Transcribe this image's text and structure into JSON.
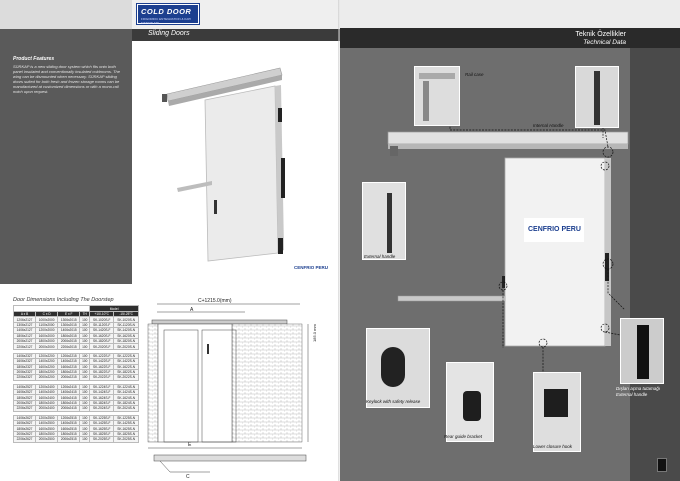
{
  "brand": {
    "logo_text": "COLD DOOR",
    "logo_subtext": "FRIGORIFIC ENTEGRATION & KAPI SISTEMLERI",
    "door_badge": "CENFRIO PERU"
  },
  "left_page": {
    "section_label": "Sliding Doors",
    "features_title": "Product Features",
    "features_text": "SÜRKAP is a new sliding door system which fits onto both panel insulated and conventionally insulated coldrooms. The wing can be dismounted when necessary. SÜRKAP sliding doors suited for both fresh and frozen storage rooms can be manufactured at customized dimensions or with a mono-rail notch upon request.",
    "dimensions_title": "Door Dimensions Including The Doorstep",
    "table": {
      "model_label": "Model",
      "columns": [
        "A x B",
        "C x D",
        "E x F",
        "TH",
        "+10/-10°C",
        "-15/-25°C"
      ],
      "groups": [
        [
          [
            "1206x2127",
            "1000x2000",
            "1306x2015",
            "100",
            "SK-1020S-F",
            "SK-1020S-N"
          ],
          [
            "1306x2127",
            "1100x2000",
            "1306x2015",
            "100",
            "SK-1120S-F",
            "SK-1120S-N"
          ],
          [
            "1406x2127",
            "1200x2000",
            "1406x2015",
            "100",
            "SK-1420S-F",
            "SK-1420S-N"
          ],
          [
            "1806x2127",
            "1600x2000",
            "1806x2015",
            "100",
            "SK-1620S-F",
            "SK-1620S-N"
          ],
          [
            "2006x2127",
            "1800x2000",
            "2006x2015",
            "100",
            "SK-1820S-F",
            "SK-1820S-N"
          ],
          [
            "2206x2127",
            "2000x2000",
            "2206x2015",
            "100",
            "SK-2020S-F",
            "SK-2020S-N"
          ]
        ],
        [
          [
            "1406x2327",
            "1200x2200",
            "1206x2215",
            "100",
            "SK-1222S-F",
            "SK-1222S-N"
          ],
          [
            "1606x2327",
            "1400x2200",
            "1406x2215",
            "100",
            "SK-1422S-F",
            "SK-1422S-N"
          ],
          [
            "1806x2327",
            "1600x2200",
            "1606x2215",
            "100",
            "SK-1622S-F",
            "SK-1622S-N"
          ],
          [
            "2006x2327",
            "1800x2200",
            "1806x2215",
            "100",
            "SK-1822S-F",
            "SK-1822S-N"
          ],
          [
            "2206x2327",
            "2000x2200",
            "2006x2215",
            "100",
            "SK-2022S-F",
            "SK-2022S-N"
          ]
        ],
        [
          [
            "1406x2527",
            "1200x2400",
            "1206x2415",
            "100",
            "SK-1224S-F",
            "SK-1224S-N"
          ],
          [
            "1606x2527",
            "1400x2400",
            "1406x2415",
            "100",
            "SK-1424S-F",
            "SK-1424S-N"
          ],
          [
            "1806x2527",
            "1600x2400",
            "1606x2415",
            "100",
            "SK-1624S-F",
            "SK-1624S-N"
          ],
          [
            "2006x2527",
            "1800x2400",
            "1806x2415",
            "100",
            "SK-1824S-F",
            "SK-1824S-N"
          ],
          [
            "2206x2527",
            "2000x2400",
            "2006x2415",
            "100",
            "SK-2024S-F",
            "SK-2024S-N"
          ]
        ],
        [
          [
            "1406x2627",
            "1200x2500",
            "1206x2515",
            "100",
            "SK-1225S-F",
            "SK-1225S-N"
          ],
          [
            "1606x2627",
            "1400x2500",
            "1406x2515",
            "100",
            "SK-1425S-F",
            "SK-1425S-N"
          ],
          [
            "1806x2627",
            "1600x2500",
            "1606x2515",
            "100",
            "SK-1625S-F",
            "SK-1625S-N"
          ],
          [
            "2006x2627",
            "1800x2500",
            "1806x2515",
            "100",
            "SK-1825S-F",
            "SK-1825S-N"
          ],
          [
            "2206x2627",
            "2000x2500",
            "2006x2515",
            "100",
            "SK-2025S-F",
            "SK-2025S-N"
          ]
        ]
      ]
    },
    "drawing": {
      "dim_top": "C+1215.0(mm)",
      "dim_a": "A",
      "dim_right": "185.0 mm",
      "dim_e": "E",
      "dim_c": "C"
    }
  },
  "right_page": {
    "title_tr": "Teknik Özellikler",
    "title_en": "Technical Data",
    "captions": {
      "rail_case": "Rail case",
      "internal_handle": "Internal Handle",
      "external_handle": "External handle",
      "keylock": "Keylock with safety release",
      "rear_guide": "Rear guide bracket",
      "lower_closure": "Lower closure hook",
      "ext_handle_tr": "Dışları açma tutamağı",
      "ext_handle_en": "External handle"
    }
  }
}
